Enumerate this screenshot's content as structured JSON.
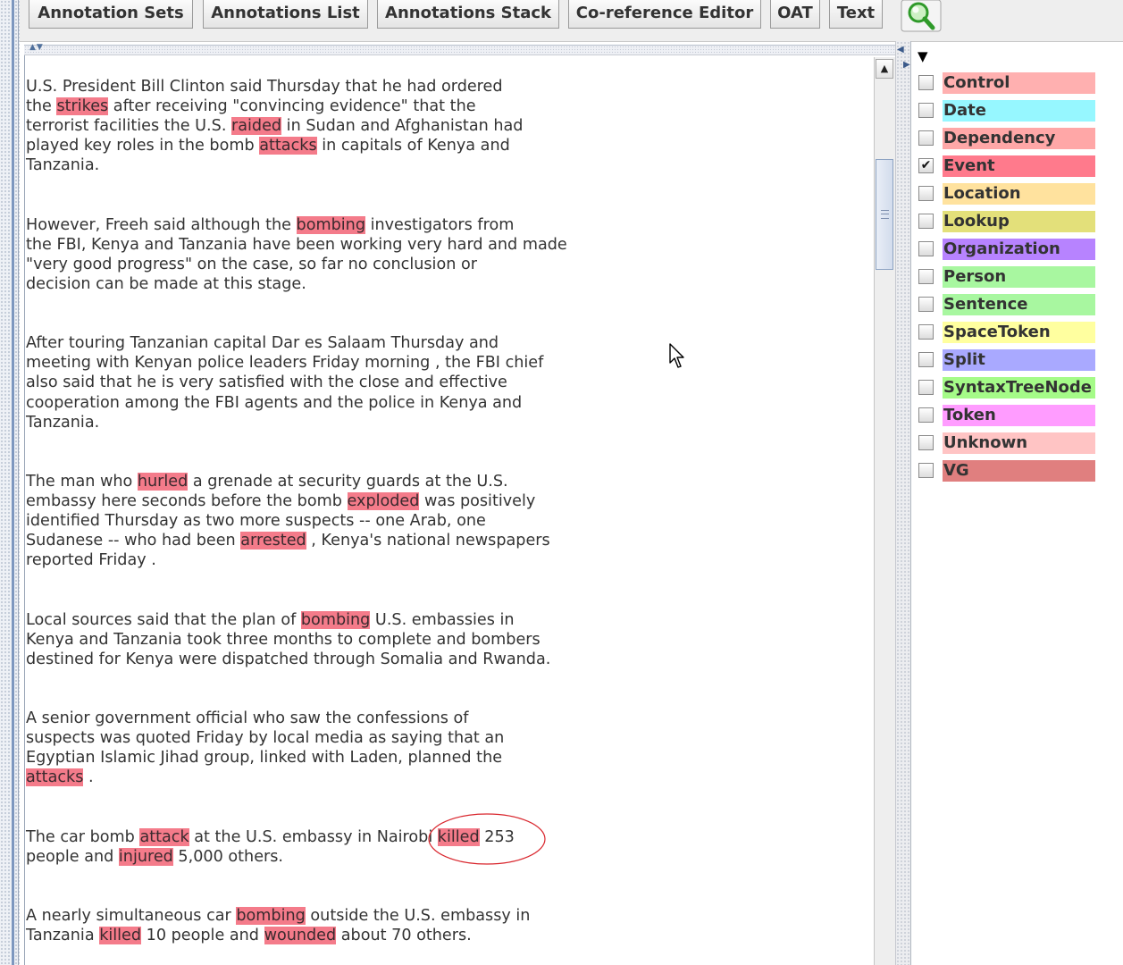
{
  "toolbar": {
    "tabs": [
      {
        "label": "Annotation Sets",
        "selected": true
      },
      {
        "label": "Annotations List",
        "selected": false
      },
      {
        "label": "Annotations Stack",
        "selected": false
      },
      {
        "label": "Co-reference Editor",
        "selected": false
      },
      {
        "label": "OAT",
        "selected": false
      },
      {
        "label": "Text",
        "selected": true
      }
    ],
    "search_icon": "magnifier-icon"
  },
  "document": {
    "highlight_color": "#f47b8a",
    "paragraphs": [
      [
        {
          "t": "U.S. President Bill Clinton said Thursday that he had ordered\nthe "
        },
        {
          "t": "strikes",
          "h": true
        },
        {
          "t": " after receiving \"convincing evidence\" that the\nterrorist facilities the U.S. "
        },
        {
          "t": "raided",
          "h": true
        },
        {
          "t": " in Sudan and Afghanistan had\nplayed key roles in the bomb "
        },
        {
          "t": "attacks",
          "h": true
        },
        {
          "t": " in capitals of Kenya and\nTanzania."
        }
      ],
      [
        {
          "t": "However, Freeh said although the "
        },
        {
          "t": "bombing",
          "h": true
        },
        {
          "t": " investigators from\nthe FBI, Kenya and Tanzania have been working very hard and made\n\"very good progress\" on the case, so far no conclusion or\ndecision can be made at this stage."
        }
      ],
      [
        {
          "t": "After touring Tanzanian capital Dar es Salaam Thursday and\nmeeting with Kenyan police leaders Friday morning , the FBI chief\nalso said that he is very satisfied with the close and effective\ncooperation among the FBI agents and the police in Kenya and\nTanzania."
        }
      ],
      [
        {
          "t": "The man who "
        },
        {
          "t": "hurled",
          "h": true
        },
        {
          "t": " a grenade at security guards at the U.S.\nembassy here seconds before the bomb "
        },
        {
          "t": "exploded",
          "h": true
        },
        {
          "t": " was positively\nidentified Thursday as two more suspects -- one Arab, one\nSudanese -- who had been "
        },
        {
          "t": "arrested",
          "h": true
        },
        {
          "t": " , Kenya's national newspapers\nreported Friday ."
        }
      ],
      [
        {
          "t": "Local sources said that the plan of "
        },
        {
          "t": "bombing",
          "h": true
        },
        {
          "t": " U.S. embassies in\nKenya and Tanzania took three months to complete and bombers\ndestined for Kenya were dispatched through Somalia and Rwanda."
        }
      ],
      [
        {
          "t": "A senior government official who saw the confessions of\nsuspects was quoted Friday by local media as saying that an\nEgyptian Islamic Jihad group, linked with Laden, planned the\n"
        },
        {
          "t": "attacks",
          "h": true
        },
        {
          "t": " ."
        }
      ],
      [
        {
          "t": "The car bomb "
        },
        {
          "t": "attack",
          "h": true
        },
        {
          "t": " at the U.S. embassy in Nairobi "
        },
        {
          "t": "killed",
          "h": true
        },
        {
          "t": " 253\npeople and "
        },
        {
          "t": "injured",
          "h": true
        },
        {
          "t": " 5,000 others."
        }
      ],
      [
        {
          "t": "A nearly simultaneous car "
        },
        {
          "t": "bombing",
          "h": true
        },
        {
          "t": " outside the U.S. embassy in\nTanzania "
        },
        {
          "t": "killed",
          "h": true
        },
        {
          "t": " 10 people and "
        },
        {
          "t": "wounded",
          "h": true
        },
        {
          "t": " about 70 others."
        }
      ]
    ]
  },
  "annotation_types": [
    {
      "name": "Control",
      "color": "#ffb0b0",
      "checked": false
    },
    {
      "name": "Date",
      "color": "#96f7ff",
      "checked": false
    },
    {
      "name": "Dependency",
      "color": "#ffa7a7",
      "checked": false
    },
    {
      "name": "Event",
      "color": "#ff7a8c",
      "checked": true
    },
    {
      "name": "Location",
      "color": "#ffe29e",
      "checked": false
    },
    {
      "name": "Lookup",
      "color": "#e3e07a",
      "checked": false
    },
    {
      "name": "Organization",
      "color": "#b783ff",
      "checked": false
    },
    {
      "name": "Person",
      "color": "#a8f7a0",
      "checked": false
    },
    {
      "name": "Sentence",
      "color": "#a8f7a0",
      "checked": false
    },
    {
      "name": "SpaceToken",
      "color": "#ffff9f",
      "checked": false
    },
    {
      "name": "Split",
      "color": "#a9a9ff",
      "checked": false
    },
    {
      "name": "SyntaxTreeNode",
      "color": "#a5fb88",
      "checked": false
    },
    {
      "name": "Token",
      "color": "#ff9cff",
      "checked": false
    },
    {
      "name": "Unknown",
      "color": "#ffc4c4",
      "checked": false
    },
    {
      "name": "VG",
      "color": "#e07f7f",
      "checked": false
    }
  ],
  "checkmark": "✔"
}
